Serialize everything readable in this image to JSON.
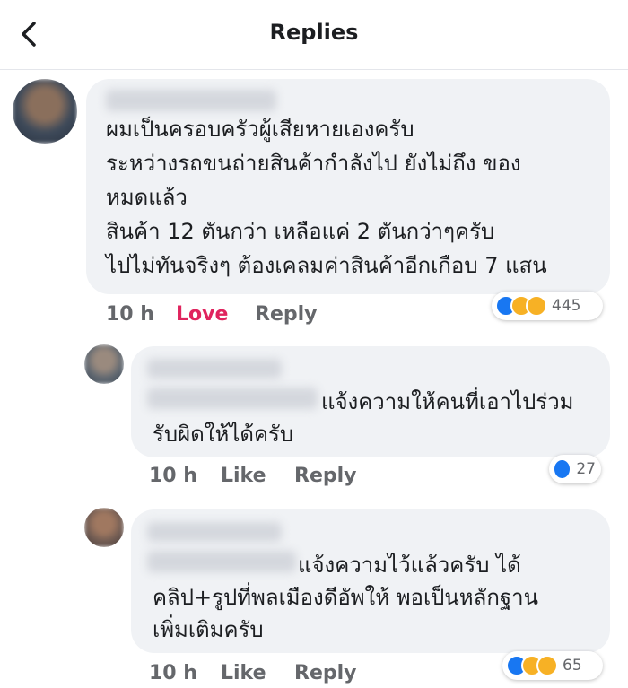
{
  "header": {
    "title": "Replies"
  },
  "comments": [
    {
      "lines": [
        "ผมเป็นครอบครัวผู้เสียหายเองครับ",
        "ระหว่างรถขนถ่ายสินค้ากำลังไป ยังไม่ถึง ของ",
        "หมดแล้ว",
        "สินค้า 12 ตันกว่า เหลือแค่ 2 ตันกว่าๆครับ",
        "ไปไม่ทันจริงๆ  ต้องเคลมค่าสินค้าอีกเกือบ 7 แสน"
      ],
      "time": "10 h",
      "like_label": "Love",
      "reply_label": "Reply",
      "reactions": [
        "like-icon",
        "sad-icon",
        "wow-icon"
      ],
      "reaction_count": "445"
    },
    {
      "lines": [
        "แจ้งความให้คนที่เอาไปร่วม",
        "รับผิดให้ได้ครับ"
      ],
      "time": "10 h",
      "like_label": "Like",
      "reply_label": "Reply",
      "reactions": [
        "like-icon"
      ],
      "reaction_count": "27"
    },
    {
      "lines": [
        "แจ้งความไว้แล้วครับ ได้",
        "คลิป+รูปที่พลเมืองดีอัพให้ พอเป็นหลักฐาน",
        "เพิ่มเติมครับ"
      ],
      "time": "10 h",
      "like_label": "Like",
      "reply_label": "Reply",
      "reactions": [
        "like-icon",
        "wow-icon",
        "care-icon"
      ],
      "reaction_count": "65"
    }
  ],
  "colors": {
    "love": "#e0245e",
    "like": "#1877f2",
    "meta": "#65676b",
    "bubble": "#f0f2f5"
  }
}
